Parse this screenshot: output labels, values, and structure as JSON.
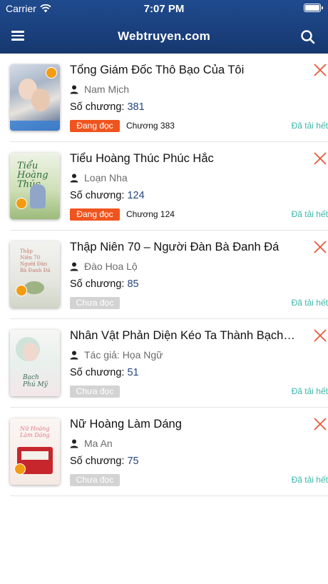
{
  "status_bar": {
    "carrier": "Carrier",
    "time": "7:07 PM"
  },
  "nav": {
    "title": "Webtruyen.com",
    "menu_icon": "hamburger-menu-icon",
    "search_icon": "search-icon"
  },
  "labels": {
    "chapters_prefix": "Số chương:",
    "downloaded": "Đã tải hết"
  },
  "colors": {
    "header": "#1a3f7c",
    "reading_tag": "#f0541e",
    "unread_tag": "#d3d3d3",
    "downloaded_text": "#3bb6a7",
    "remove_icon": "#e8583a",
    "chapter_count": "#27457d"
  },
  "books": [
    {
      "title": "Tổng Giám Đốc Thô Bạo Của Tôi",
      "author": "Nam Mịch",
      "chapters": "381",
      "status": "Đang đọc",
      "current": "Chương 383",
      "downloaded": "Đã tải hết"
    },
    {
      "title": "Tiểu Hoàng Thúc Phúc Hắc",
      "author": "Loạn Nha",
      "chapters": "124",
      "status": "Đang đọc",
      "current": "Chương 124",
      "downloaded": "Đã tải hết"
    },
    {
      "title": "Thập Niên 70 – Người Đàn Bà Đanh Đá",
      "author": "Đào Hoa Lộ",
      "chapters": "85",
      "status": "Chưa đọc",
      "current": "",
      "downloaded": "Đã tải hết"
    },
    {
      "title": "Nhân Vật Phản Diện Kéo Ta Thành Bạch Phú Mỹ",
      "author": "Tác giả: Họa Ngữ",
      "chapters": "51",
      "status": "Chưa đọc",
      "current": "",
      "downloaded": "Đã tải hết"
    },
    {
      "title": "Nữ Hoàng Làm Dáng",
      "author": "Ma An",
      "chapters": "75",
      "status": "Chưa đọc",
      "current": "",
      "downloaded": "Đã tải hết"
    }
  ]
}
